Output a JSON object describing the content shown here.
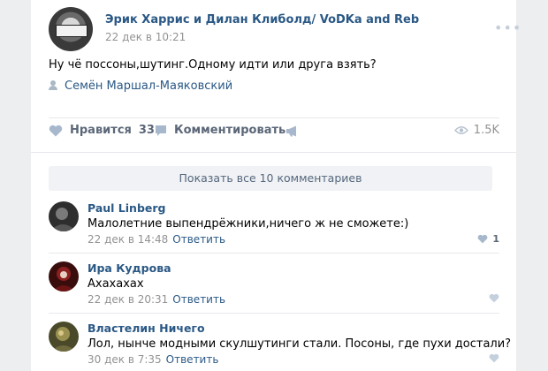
{
  "post": {
    "author": "Эрик Харрис и Дилан Клиболд/ VoDKa and Reb",
    "date": "22 дек в 10:21",
    "more": "•••",
    "text": "Ну чё поссоны,шутинг.Одному идти или друга взять?",
    "signer": "Семён Маршал-Маяковский"
  },
  "actions": {
    "like_label": "Нравится",
    "like_count": "33",
    "comment_label": "Комментировать",
    "views": "1.5K"
  },
  "show_all_label": "Показать все 10 комментариев",
  "comments": [
    {
      "name": "Paul Linberg",
      "text": "Малолетние выпендрёжники,ничего ж не сможете:)",
      "date": "22 дек в 14:48",
      "reply": "Ответить",
      "likes": "1"
    },
    {
      "name": "Ира Кудрова",
      "text": "Ахахахах",
      "date": "22 дек в 20:31",
      "reply": "Ответить",
      "likes": ""
    },
    {
      "name": "Властелин Ничего",
      "text": "Лол, нынче модными скулшутинги стали. Посоны, где пухи достали?",
      "date": "30 дек в 7:35",
      "reply": "Ответить",
      "likes": ""
    }
  ],
  "icons": {
    "like": "heart-icon",
    "comment": "comment-bubble-icon",
    "share": "megaphone-icon",
    "views": "eye-icon",
    "signer": "person-icon"
  },
  "colors": {
    "link": "#2a5885",
    "meta": "#939393",
    "action": "#5b6778",
    "background": "#edeef0"
  }
}
